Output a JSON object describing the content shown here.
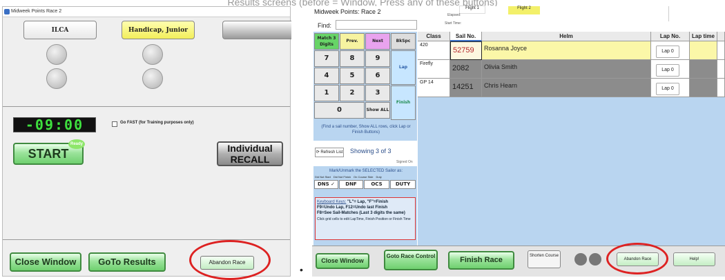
{
  "caption_top": "Results screens (before = Window, Press any of these buttons)",
  "left": {
    "window_title": "Midweek Points Race 2",
    "class_tabs": [
      "ILCA",
      "Handicap, Junior",
      ""
    ],
    "timer": "-09:00",
    "go_fast_label": "Go FAST (for Training purposes only)",
    "start_label": "START",
    "ready_badge": "Ready",
    "individual_recall_label": "Individual RECALL",
    "close_window_label": "Close Window",
    "goto_results_label": "GoTo Results",
    "abandon_race_label": "Abandon Race"
  },
  "bullet": "•",
  "right": {
    "title": "Midweek Points: Race 2",
    "flight1": "Flight 1",
    "flight2": "Flight 2",
    "elapsed_label": "Elapsed:",
    "start_time_label": "Start Time:",
    "find_label": "Find:",
    "keypad": {
      "top": [
        "Match 3 Digits",
        "Prev.",
        "Next",
        "BkSpc"
      ],
      "digits": [
        "7",
        "8",
        "9",
        "4",
        "5",
        "6",
        "1",
        "2",
        "3",
        "0"
      ],
      "show_all": "Show ALL",
      "lap": "Lap",
      "finish": "Finish"
    },
    "hint": "(Find a sail number, Show ALL rows, click Lap or Finish Buttons)",
    "refresh_label": "Refresh List",
    "showing": "Showing 3 of 3",
    "signed_on": "Signed On",
    "mark_label": "Mark/Unmark the SELECTED Sailor as:",
    "status_small": [
      "Did Not Start",
      "Did Not Finish",
      "On Course Side",
      "Duty"
    ],
    "status_buttons": [
      "DNS ✓",
      "DNF",
      "OCS",
      "DUTY"
    ],
    "kb_title": "Keyboard Keys:",
    "kb_line1": "\"L\"= Lap, \"F\"=Finish",
    "kb_line2": "F9=Undo Lap, F12=Undo last Finish",
    "kb_line3": "F8=See Sail-Matches (Last 3 digits the same)",
    "kb_note": "Click grid cells to edit LapTime, Finish Position or Finish Time",
    "columns": [
      "Class",
      "Sail No.",
      "Helm",
      "Lap No.",
      "Lap time"
    ],
    "rows": [
      {
        "class": "420",
        "sail": "52759",
        "helm": "Rosanna Joyce",
        "lap": "Lap 0"
      },
      {
        "class": "Firefly",
        "sail": "2082",
        "helm": "Olivia Smith",
        "lap": "Lap 0"
      },
      {
        "class": "GP 14",
        "sail": "14251",
        "helm": "Chris Hearn",
        "lap": "Lap 0"
      }
    ],
    "close_window_label": "Close Window",
    "goto_race_control_label": "Goto Race Control",
    "finish_race_label": "Finish Race",
    "shorten_course_label": "Shorten Course",
    "abandon_race_label": "Abandon Race",
    "help_label": "Help!"
  }
}
